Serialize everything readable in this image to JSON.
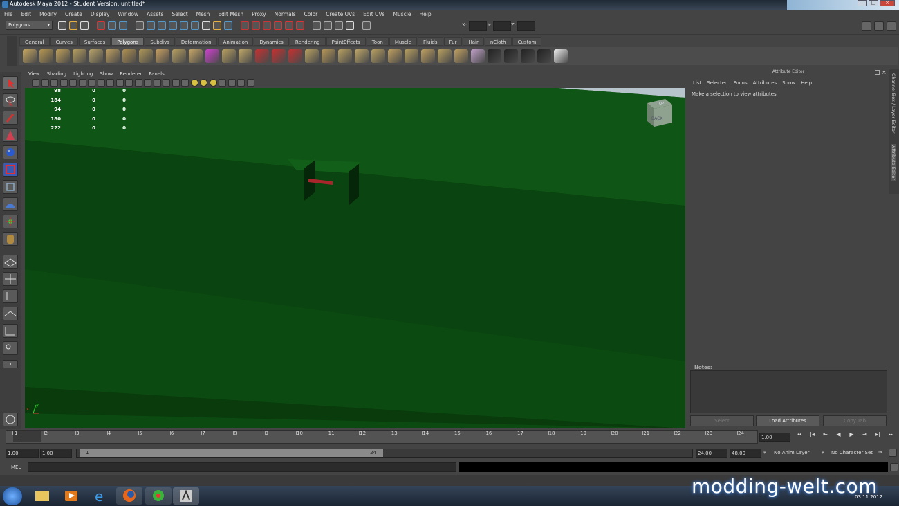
{
  "window": {
    "title": "Autodesk Maya 2012 - Student Version: untitled*"
  },
  "menubar": [
    "File",
    "Edit",
    "Modify",
    "Create",
    "Display",
    "Window",
    "Assets",
    "Select",
    "Mesh",
    "Edit Mesh",
    "Proxy",
    "Normals",
    "Color",
    "Create UVs",
    "Edit UVs",
    "Muscle",
    "Help"
  ],
  "statusline": {
    "menu_set": "Polygons",
    "x_label": "X:",
    "y_label": "Y:",
    "z_label": "Z:"
  },
  "shelf_tabs": [
    "General",
    "Curves",
    "Surfaces",
    "Polygons",
    "Subdivs",
    "Deformation",
    "Animation",
    "Dynamics",
    "Rendering",
    "PaintEffects",
    "Toon",
    "Muscle",
    "Fluids",
    "Fur",
    "Hair",
    "nCloth",
    "Custom"
  ],
  "shelf_active": "Polygons",
  "panel_menu": [
    "View",
    "Shading",
    "Lighting",
    "Show",
    "Renderer",
    "Panels"
  ],
  "hud": [
    {
      "a": "98",
      "b": "0",
      "c": "0"
    },
    {
      "a": "184",
      "b": "0",
      "c": "0"
    },
    {
      "a": "94",
      "b": "0",
      "c": "0"
    },
    {
      "a": "180",
      "b": "0",
      "c": "0"
    },
    {
      "a": "222",
      "b": "0",
      "c": "0"
    }
  ],
  "viewcube": {
    "top": "TOP",
    "back": "BACK"
  },
  "axis": {
    "x": "x",
    "y": "y"
  },
  "attribute_editor": {
    "title": "Attribute Editor",
    "menu": [
      "List",
      "Selected",
      "Focus",
      "Attributes",
      "Show",
      "Help"
    ],
    "message": "Make a selection to view attributes",
    "notes_label": "Notes:",
    "buttons": {
      "select": "Select",
      "load": "Load Attributes",
      "copy": "Copy Tab"
    }
  },
  "side_tabs": [
    "Channel Box / Layer Editor",
    "Attribute Editor"
  ],
  "timeline": {
    "ticks": [
      "1",
      "2",
      "3",
      "4",
      "5",
      "6",
      "7",
      "8",
      "9",
      "10",
      "11",
      "12",
      "13",
      "14",
      "15",
      "16",
      "17",
      "18",
      "19",
      "20",
      "21",
      "22",
      "23",
      "24"
    ],
    "current_marker": "1",
    "current_frame": "1.00"
  },
  "range": {
    "start_outer": "1.00",
    "start_inner": "1.00",
    "slider_start": "1",
    "slider_end": "24",
    "end_inner": "24.00",
    "end_outer": "48.00",
    "anim_layer": "No Anim Layer",
    "char_set": "No Character Set"
  },
  "mel": {
    "label": "MEL"
  },
  "taskbar": {
    "clock_date": "03.11.2012"
  },
  "watermark": "modding-welt.com",
  "colors": {
    "viewport_green": "#0d4d12",
    "ui_gray": "#444444",
    "selected_tab": "#6a6a6a"
  }
}
